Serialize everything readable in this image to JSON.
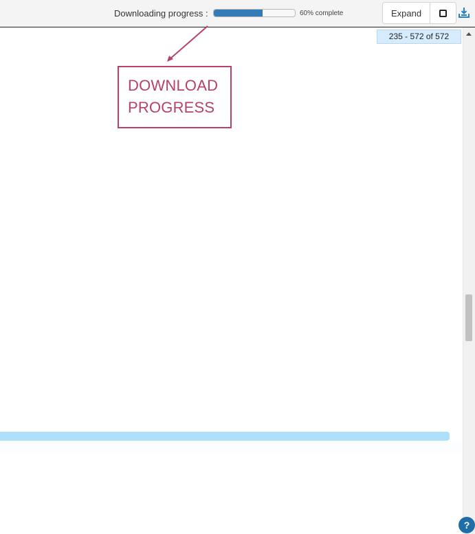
{
  "toolbar": {
    "progress_label": "Downloading progress :",
    "progress_fraction": 0.6,
    "progress_text": "60% complete",
    "expand_label": "Expand",
    "square_icon": "stop-square-icon",
    "download_icon": "download-tray-icon"
  },
  "range": {
    "text": "235 - 572 of 572"
  },
  "annotation": {
    "line1": "DOWNLOAD",
    "line2": "PROGRESS",
    "color": "#b94068"
  },
  "help": {
    "label": "?",
    "icon": "help-icon"
  },
  "colors": {
    "progress_fill": "#337ab7",
    "range_bg": "#d6ebfb",
    "row_highlight": "#ade0fb",
    "help_bg": "#1e6fa8"
  }
}
